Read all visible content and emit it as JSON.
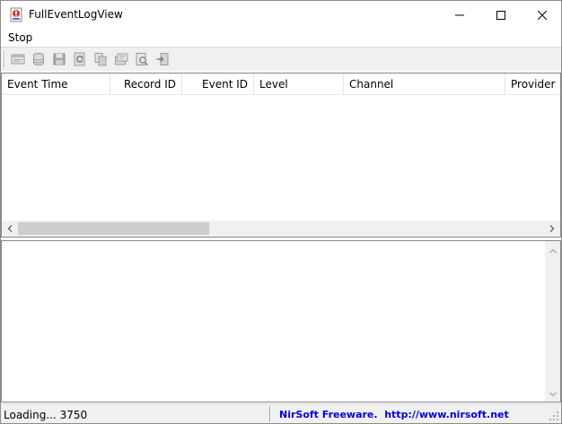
{
  "window": {
    "title": "FullEventLogView",
    "controls": {
      "minimize": "minimize",
      "maximize": "maximize",
      "close": "close"
    }
  },
  "menu": {
    "items": [
      "Stop"
    ]
  },
  "toolbar": {
    "buttons": [
      {
        "icon": "properties-icon"
      },
      {
        "icon": "database-icon"
      },
      {
        "icon": "save-icon"
      },
      {
        "icon": "refresh-icon"
      },
      {
        "icon": "copy-icon"
      },
      {
        "icon": "html-report-icon"
      },
      {
        "icon": "find-icon"
      },
      {
        "icon": "exit-icon"
      }
    ]
  },
  "list": {
    "columns": [
      {
        "label": "Event Time",
        "align": "left"
      },
      {
        "label": "Record ID",
        "align": "right"
      },
      {
        "label": "Event ID",
        "align": "right"
      },
      {
        "label": "Level",
        "align": "left"
      },
      {
        "label": "Channel",
        "align": "left"
      },
      {
        "label": "Provider",
        "align": "left"
      }
    ],
    "rows": []
  },
  "status": {
    "left": "Loading... 3750",
    "right": "NirSoft Freeware.  http://www.nirsoft.net"
  },
  "colors": {
    "link": "#0000e0",
    "chrome": "#f0f0f0"
  }
}
